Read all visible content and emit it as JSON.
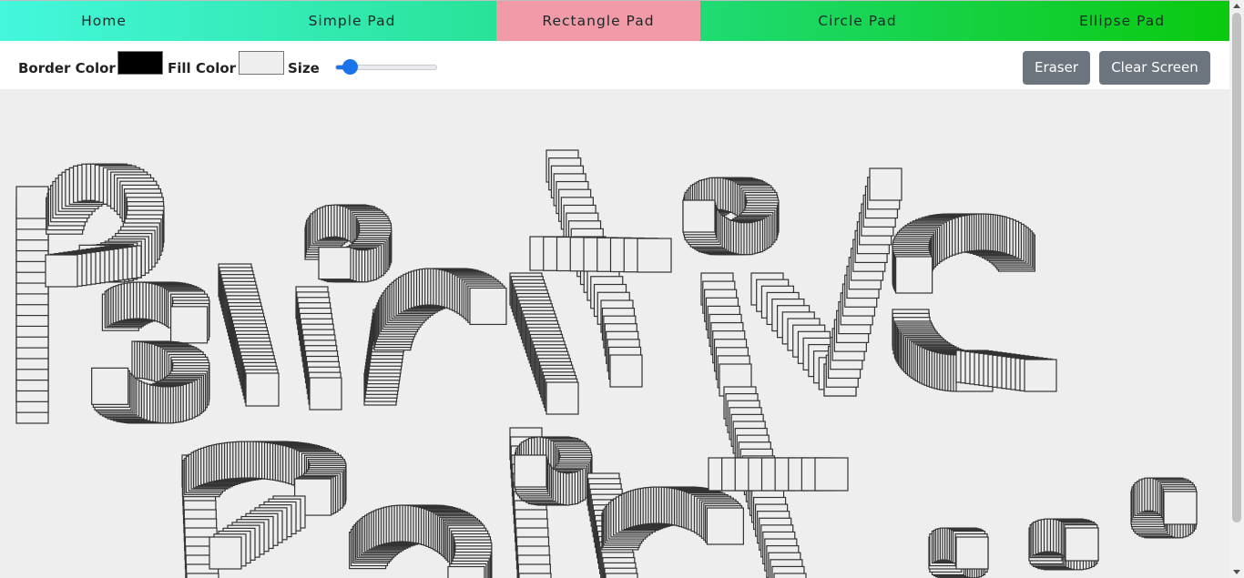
{
  "nav": {
    "items": [
      {
        "label": "Home",
        "active": false
      },
      {
        "label": "Simple Pad",
        "active": false
      },
      {
        "label": "Rectangle Pad",
        "active": true
      },
      {
        "label": "Circle Pad",
        "active": false
      },
      {
        "label": "Ellipse Pad",
        "active": false
      }
    ]
  },
  "toolbar": {
    "border_color_label": "Border Color :",
    "border_color": "#000000",
    "fill_color_label": "Fill Color :",
    "fill_color": "#eeeeee",
    "size_label": "Size",
    "size_value_fraction": 0.08,
    "eraser_label": "Eraser",
    "clear_label": "Clear Screen"
  },
  "colors": {
    "active_tab": "#f39aa8",
    "slider_accent": "#1a73e8",
    "button_bg": "#6c757d",
    "canvas_bg": "#eeeeee",
    "stroke": "#333333"
  }
}
